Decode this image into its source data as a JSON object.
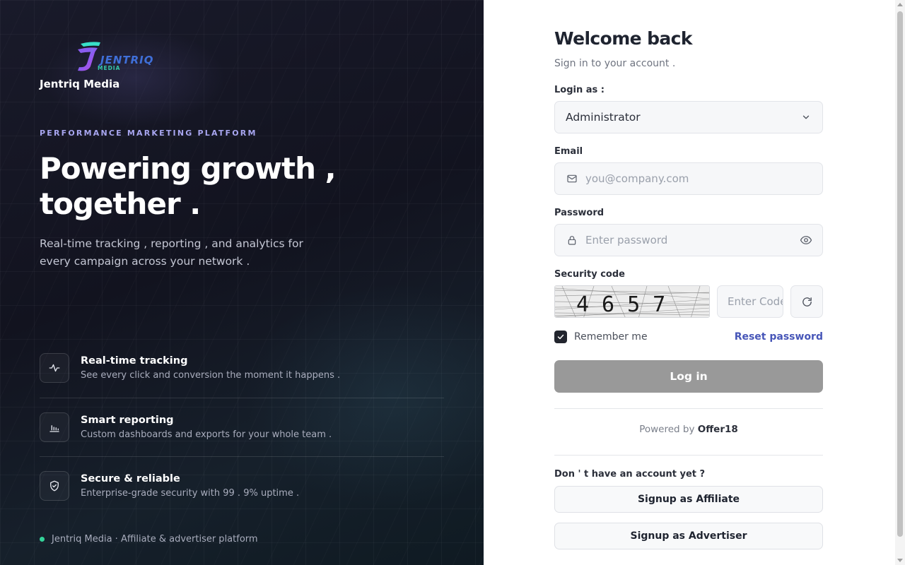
{
  "brand": {
    "logo_text": "JENTRIQ",
    "logo_sub": "MEDIA",
    "name": "Jentriq Media"
  },
  "hero": {
    "eyebrow": "PERFORMANCE MARKETING PLATFORM",
    "headline_line1": "Powering growth ,",
    "headline_line2": "together .",
    "subtext": "Real-time tracking , reporting , and analytics for every campaign across your network ."
  },
  "features": [
    {
      "icon": "activity-icon",
      "title": "Real-time tracking",
      "desc": "See every click and conversion the moment it happens ."
    },
    {
      "icon": "bar-chart-icon",
      "title": "Smart reporting",
      "desc": "Custom dashboards and exports for your whole team ."
    },
    {
      "icon": "shield-check-icon",
      "title": "Secure & reliable",
      "desc": "Enterprise-grade security with 99 . 9% uptime ."
    }
  ],
  "footer_left": "Jentriq Media · Affiliate & advertiser platform",
  "form": {
    "title": "Welcome back",
    "subtitle": "Sign in to your account .",
    "login_as_label": "Login as :",
    "login_as_value": "Administrator",
    "email_label": "Email",
    "email_placeholder": "you@company.com",
    "password_label": "Password",
    "password_placeholder": "Enter password",
    "security_label": "Security code",
    "captcha_code": "4657",
    "captcha_placeholder": "Enter Code",
    "remember_label": "Remember me",
    "remember_checked": true,
    "reset_link": "Reset password",
    "login_button": "Log in",
    "powered_prefix": "Powered by",
    "powered_brand": "Offer18",
    "no_account": "Don ' t have an account yet ?",
    "signup_affiliate": "Signup as Affiliate",
    "signup_advertiser": "Signup as Advertiser"
  },
  "colors": {
    "accent": "#4756b8",
    "eyebrow": "#a8a6f0",
    "status_dot": "#34d399",
    "login_button": "#999999"
  }
}
